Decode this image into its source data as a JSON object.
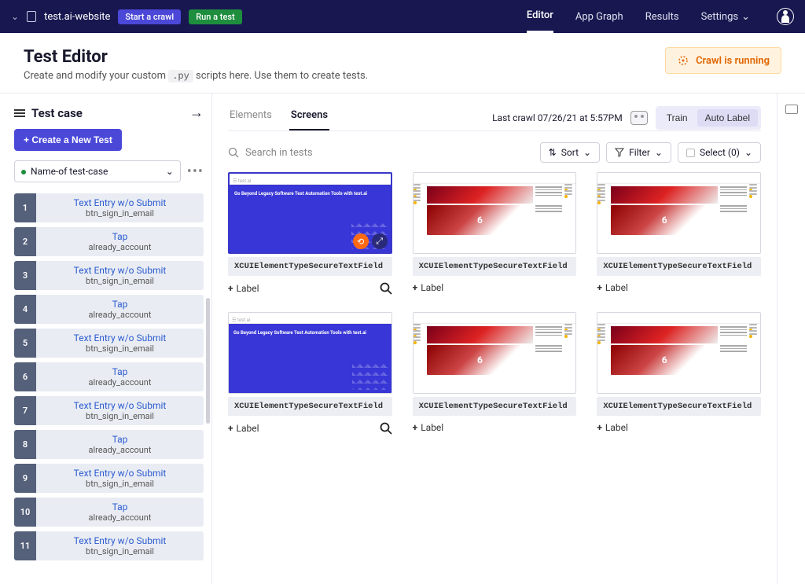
{
  "nav": {
    "project": "test.ai-website",
    "start_crawl": "Start a crawl",
    "run_test": "Run a test",
    "tabs": [
      "Editor",
      "App Graph",
      "Results"
    ],
    "active_tab": 0,
    "settings": "Settings"
  },
  "header": {
    "title": "Test Editor",
    "subtitle_pre": "Create and modify your custom ",
    "subtitle_code": ".py",
    "subtitle_post": " scripts here. Use them to create tests.",
    "crawl_badge": "Crawl is running"
  },
  "sidebar": {
    "title": "Test case",
    "new_test": "+ Create a New Test",
    "select_value": "Name-of test-case",
    "steps": [
      {
        "n": "1",
        "t": "Text Entry w/o Submit",
        "s": "btn_sign_in_email"
      },
      {
        "n": "2",
        "t": "Tap",
        "s": "already_account"
      },
      {
        "n": "3",
        "t": "Text Entry w/o Submit",
        "s": "btn_sign_in_email"
      },
      {
        "n": "4",
        "t": "Tap",
        "s": "already_account"
      },
      {
        "n": "5",
        "t": "Text Entry w/o Submit",
        "s": "btn_sign_in_email"
      },
      {
        "n": "6",
        "t": "Tap",
        "s": "already_account"
      },
      {
        "n": "7",
        "t": "Text Entry w/o Submit",
        "s": "btn_sign_in_email"
      },
      {
        "n": "8",
        "t": "Tap",
        "s": "already_account"
      },
      {
        "n": "9",
        "t": "Text Entry w/o Submit",
        "s": "btn_sign_in_email"
      },
      {
        "n": "10",
        "t": "Tap",
        "s": "already_account"
      },
      {
        "n": "11",
        "t": "Text Entry w/o Submit",
        "s": "btn_sign_in_email"
      }
    ]
  },
  "content": {
    "tabs": [
      "Elements",
      "Screens"
    ],
    "active_tab": 1,
    "last_crawl": "Last crawl 07/26/21 at 5:57PM",
    "train": "Train",
    "auto_label": "Auto Label",
    "search_placeholder": "Search in tests",
    "sort": "Sort",
    "filter": "Filter",
    "select": "Select (0)",
    "thumb_text": "Go Beyond Legacy Software Test Automation Tools with test.ai",
    "thumb_brand": "test.ai",
    "cards": [
      {
        "variant": "blue",
        "selected": true,
        "label": "XCUIElementTypeSecureTextField",
        "add": "Label",
        "search": true
      },
      {
        "variant": "news",
        "selected": false,
        "label": "XCUIElementTypeSecureTextField",
        "add": "Label",
        "search": false
      },
      {
        "variant": "news",
        "selected": false,
        "label": "XCUIElementTypeSecureTextField",
        "add": "Label",
        "search": false
      },
      {
        "variant": "blue",
        "selected": false,
        "label": "XCUIElementTypeSecureTextField",
        "add": "Label",
        "search": true
      },
      {
        "variant": "news",
        "selected": false,
        "label": "XCUIElementTypeSecureTextField",
        "add": "Label",
        "search": false
      },
      {
        "variant": "news",
        "selected": false,
        "label": "XCUIElementTypeSecureTextField",
        "add": "Label",
        "search": false
      }
    ]
  }
}
